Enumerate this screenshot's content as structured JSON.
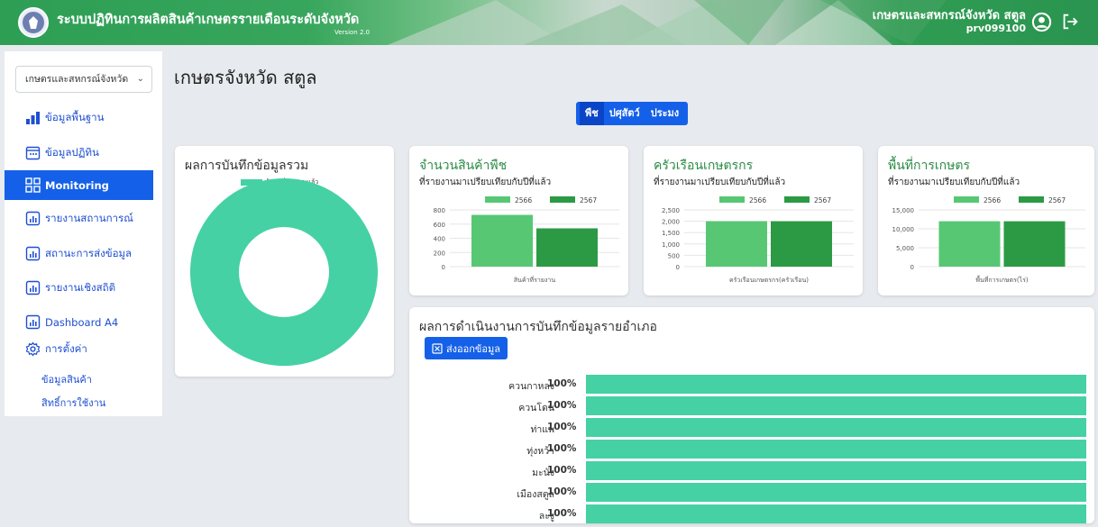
{
  "header": {
    "app_title": "ระบบปฏิทินการผลิตสินค้าเกษตรรายเดือนระดับจังหวัด",
    "version": "Version 2.0",
    "user_org": "เกษตรและสหกรณ์จังหวัด สตูล",
    "user_code": "prv099100",
    "colors": {
      "brand_green": "#2e9e55"
    }
  },
  "sidebar": {
    "org_select_value": "เกษตรและสหกรณ์จังหวัด",
    "items": [
      {
        "label": "ข้อมูลพื้นฐาน",
        "icon": "bar-chart-icon"
      },
      {
        "label": "ข้อมูลปฏิทิน",
        "icon": "calendar-icon"
      },
      {
        "label": "Monitoring",
        "icon": "grid-icon",
        "active": true
      },
      {
        "label": "รายงานสถานการณ์",
        "icon": "report-icon"
      },
      {
        "label": "สถานะการส่งข้อมูล",
        "icon": "report-icon"
      },
      {
        "label": "รายงานเชิงสถิติ",
        "icon": "report-icon"
      },
      {
        "label": "Dashboard A4",
        "icon": "report-icon"
      },
      {
        "label": "การตั้งค่า",
        "icon": "gear-icon"
      }
    ],
    "sub_items": [
      "ข้อมูลสินค้า",
      "สิทธิ์การใช้งาน"
    ]
  },
  "main": {
    "title": "เกษตรจังหวัด สตูล",
    "tabs": [
      {
        "label": "พืช",
        "active": true
      },
      {
        "label": "ปศุสัตว์",
        "active": false
      },
      {
        "label": "ประมง",
        "active": false
      }
    ],
    "summary_card": {
      "title": "ผลการบันทึกข้อมูลรวม",
      "legend": "ข้อมูลที่รายงานแล้ว",
      "color": "#45d1a3"
    },
    "compare_cards": [
      {
        "title": "จำนวนสินค้าพืช",
        "subtitle": "ที่รายงานมาเปรียบเทียบกับปีที่แล้ว",
        "chart_data": {
          "type": "bar",
          "categories": [
            "สินค้าที่รายงาน"
          ],
          "series": [
            {
              "name": "2566",
              "values": [
                730
              ],
              "color": "#57c774"
            },
            {
              "name": "2567",
              "values": [
                540
              ],
              "color": "#2c9a44"
            }
          ],
          "ylim": [
            0,
            800
          ],
          "yticks": [
            "800",
            "600",
            "400",
            "200",
            "0"
          ]
        }
      },
      {
        "title": "ครัวเรือนเกษตรกร",
        "subtitle": "ที่รายงานมาเปรียบเทียบกับปีที่แล้ว",
        "chart_data": {
          "type": "bar",
          "categories": [
            "ครัวเรือนเกษตรกร(ครัวเรือน)"
          ],
          "series": [
            {
              "name": "2566",
              "values": [
                2000
              ],
              "color": "#57c774"
            },
            {
              "name": "2567",
              "values": [
                2000
              ],
              "color": "#2c9a44"
            }
          ],
          "ylim": [
            0,
            2500
          ],
          "yticks": [
            "2,500",
            "2,000",
            "1,500",
            "1,000",
            "500",
            "0"
          ]
        }
      },
      {
        "title": "พื้นที่การเกษตร",
        "subtitle": "ที่รายงานมาเปรียบเทียบกับปีที่แล้ว",
        "chart_data": {
          "type": "bar",
          "categories": [
            "พื้นที่การเกษตร(ไร่)"
          ],
          "series": [
            {
              "name": "2566",
              "values": [
                12000
              ],
              "color": "#57c774"
            },
            {
              "name": "2567",
              "values": [
                12000
              ],
              "color": "#2c9a44"
            }
          ],
          "ylim": [
            0,
            15000
          ],
          "yticks": [
            "15,000",
            "10,000",
            "5,000",
            "0"
          ]
        }
      }
    ],
    "district_card": {
      "title": "ผลการดำเนินงานการบันทึกข้อมูลรายอำเภอ",
      "export_label": "ส่งออกข้อมูล",
      "rows": [
        {
          "name": "ควนกาหลง",
          "pct": "100%",
          "value": 100
        },
        {
          "name": "ควนโดน",
          "pct": "100%",
          "value": 100
        },
        {
          "name": "ท่าแพ",
          "pct": "100%",
          "value": 100
        },
        {
          "name": "ทุ่งหว้า",
          "pct": "100%",
          "value": 100
        },
        {
          "name": "มะนัง",
          "pct": "100%",
          "value": 100
        },
        {
          "name": "เมืองสตูล",
          "pct": "100%",
          "value": 100
        },
        {
          "name": "ละงู",
          "pct": "100%",
          "value": 100
        }
      ]
    }
  }
}
